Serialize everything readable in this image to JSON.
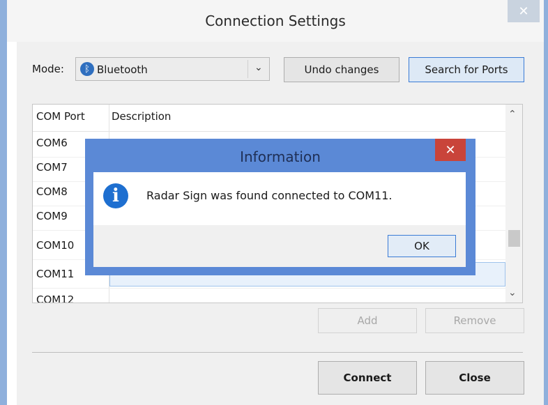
{
  "window": {
    "title": "Connection Settings",
    "close_glyph": "✕"
  },
  "mode": {
    "label": "Mode:",
    "value": "Bluetooth",
    "icon": "bluetooth-icon",
    "chevron": "⌄"
  },
  "buttons": {
    "undo": "Undo changes",
    "search": "Search for Ports",
    "add": "Add",
    "remove": "Remove",
    "connect": "Connect",
    "close": "Close"
  },
  "table": {
    "columns": [
      "COM Port",
      "Description"
    ],
    "rows": [
      {
        "port": "COM6",
        "description": ""
      },
      {
        "port": "COM7",
        "description": ""
      },
      {
        "port": "COM8",
        "description": ""
      },
      {
        "port": "COM9",
        "description": ""
      },
      {
        "port": "COM10",
        "description": ""
      },
      {
        "port": "COM11",
        "description": "",
        "selected": true
      },
      {
        "port": "COM12",
        "description": ""
      }
    ],
    "scroll_up": "⌃",
    "scroll_down": "⌄"
  },
  "info_dialog": {
    "title": "Information",
    "message": "Radar Sign was found connected to COM11.",
    "ok_label": "OK",
    "icon_glyph": "i",
    "close_glyph": "✕"
  },
  "colors": {
    "frame": "#8fb0dc",
    "dialog_frame": "#5b89d6",
    "dialog_close": "#c9443a",
    "info_icon": "#1e6fd0",
    "selection": "#e8f1fb"
  }
}
